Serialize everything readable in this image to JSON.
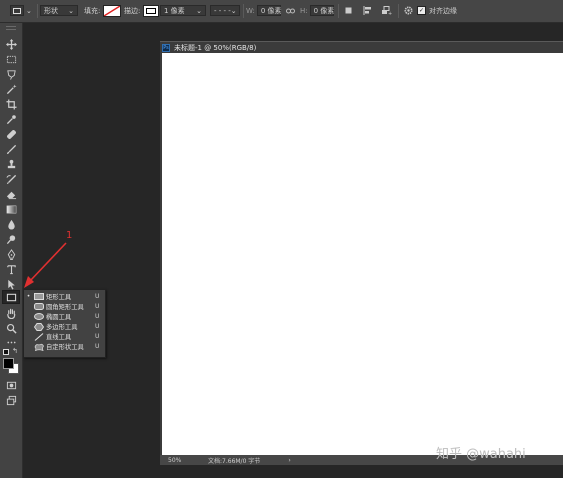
{
  "options_bar": {
    "mode_value": "形状",
    "fill_label": "填充:",
    "stroke_label": "描边:",
    "stroke_width": "1 像素",
    "w_label": "W:",
    "w_value": "0 像素",
    "h_label": "H:",
    "h_value": "0 像素",
    "align_edges_label": "对齐边缘",
    "align_edges_checked": true
  },
  "document": {
    "tab_title": "未标题-1 @ 50%(RGB/8)",
    "tab_icon": "Ps",
    "zoom": "50%",
    "doc_info": "文档:7.66M/0 字节"
  },
  "flyout": {
    "items": [
      {
        "label": "矩形工具",
        "shortcut": "U",
        "icon": "rectangle-icon",
        "selected": true
      },
      {
        "label": "圆角矩形工具",
        "shortcut": "U",
        "icon": "rounded-rectangle-icon",
        "selected": false
      },
      {
        "label": "椭圆工具",
        "shortcut": "U",
        "icon": "ellipse-icon",
        "selected": false
      },
      {
        "label": "多边形工具",
        "shortcut": "U",
        "icon": "polygon-icon",
        "selected": false
      },
      {
        "label": "直线工具",
        "shortcut": "U",
        "icon": "line-icon",
        "selected": false
      },
      {
        "label": "自定形状工具",
        "shortcut": "U",
        "icon": "custom-shape-icon",
        "selected": false
      }
    ]
  },
  "annotation": {
    "number": "1",
    "color": "#e03030"
  },
  "watermark": "知乎 @wahahi",
  "colors": {
    "toolbar": "#434343",
    "workspace": "#262626",
    "canvas": "#ffffff"
  }
}
